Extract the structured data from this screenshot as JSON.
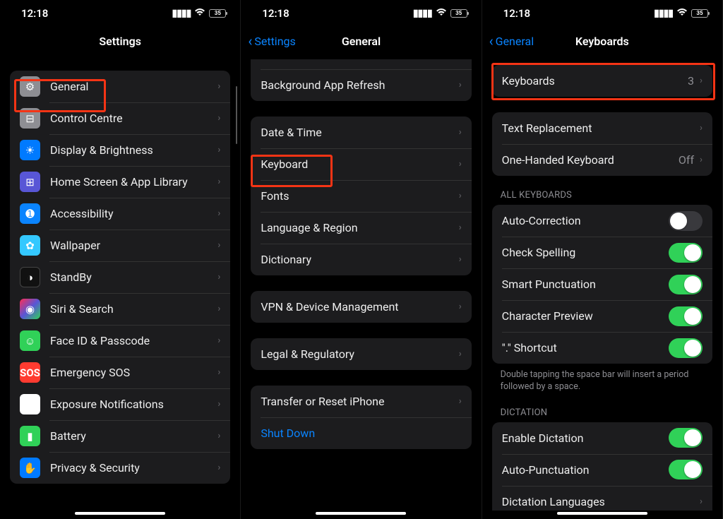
{
  "status": {
    "time": "12:18",
    "battery": "35"
  },
  "p1": {
    "title": "Settings",
    "rows": [
      {
        "name": "general",
        "label": "General",
        "icon": "gear",
        "bg": "bg-grey",
        "glyph": "⚙"
      },
      {
        "name": "control-centre",
        "label": "Control Centre",
        "icon": "switch",
        "bg": "bg-grey",
        "glyph": "⊟"
      },
      {
        "name": "display-brightness",
        "label": "Display & Brightness",
        "icon": "brightness",
        "bg": "bg-blue",
        "glyph": "☀"
      },
      {
        "name": "home-screen",
        "label": "Home Screen & App Library",
        "icon": "grid",
        "bg": "bg-purple",
        "glyph": "⊞"
      },
      {
        "name": "accessibility",
        "label": "Accessibility",
        "icon": "accessibility",
        "bg": "bg-access",
        "glyph": "➊"
      },
      {
        "name": "wallpaper",
        "label": "Wallpaper",
        "icon": "wallpaper",
        "bg": "bg-teal",
        "glyph": "✿"
      },
      {
        "name": "standby",
        "label": "StandBy",
        "icon": "standby",
        "bg": "bg-dark",
        "glyph": "◑"
      },
      {
        "name": "siri-search",
        "label": "Siri & Search",
        "icon": "siri",
        "bg": "bg-grad",
        "glyph": "◉"
      },
      {
        "name": "faceid-passcode",
        "label": "Face ID & Passcode",
        "icon": "faceid",
        "bg": "bg-green",
        "glyph": "☺"
      },
      {
        "name": "emergency-sos",
        "label": "Emergency SOS",
        "icon": "sos",
        "bg": "bg-redtx",
        "glyph": "SOS"
      },
      {
        "name": "exposure-notifications",
        "label": "Exposure Notifications",
        "icon": "exposure",
        "bg": "bg-white",
        "glyph": "✱"
      },
      {
        "name": "battery",
        "label": "Battery",
        "icon": "battery",
        "bg": "bg-greenb",
        "glyph": "▮"
      },
      {
        "name": "privacy-security",
        "label": "Privacy & Security",
        "icon": "hand",
        "bg": "bg-bluep",
        "glyph": "✋"
      }
    ]
  },
  "p2": {
    "back": "Settings",
    "title": "General",
    "group_top": [
      {
        "name": "background-app-refresh",
        "label": "Background App Refresh"
      }
    ],
    "group_mid": [
      {
        "name": "date-time",
        "label": "Date & Time"
      },
      {
        "name": "keyboard",
        "label": "Keyboard"
      },
      {
        "name": "fonts",
        "label": "Fonts"
      },
      {
        "name": "language-region",
        "label": "Language & Region"
      },
      {
        "name": "dictionary",
        "label": "Dictionary"
      }
    ],
    "group_vpn": [
      {
        "name": "vpn-device-mgmt",
        "label": "VPN & Device Management"
      }
    ],
    "group_legal": [
      {
        "name": "legal-regulatory",
        "label": "Legal & Regulatory"
      }
    ],
    "group_reset": [
      {
        "name": "transfer-reset",
        "label": "Transfer or Reset iPhone"
      },
      {
        "name": "shut-down",
        "label": "Shut Down",
        "blue": true
      }
    ]
  },
  "p3": {
    "back": "General",
    "title": "Keyboards",
    "group_kb": [
      {
        "name": "keyboards",
        "label": "Keyboards",
        "value": "3"
      }
    ],
    "group_text": [
      {
        "name": "text-replacement",
        "label": "Text Replacement"
      },
      {
        "name": "one-handed",
        "label": "One-Handed Keyboard",
        "value": "Off"
      }
    ],
    "section_all_label": "ALL KEYBOARDS",
    "group_all": [
      {
        "name": "auto-correction",
        "label": "Auto-Correction",
        "on": false
      },
      {
        "name": "check-spelling",
        "label": "Check Spelling",
        "on": true
      },
      {
        "name": "smart-punctuation",
        "label": "Smart Punctuation",
        "on": true
      },
      {
        "name": "character-preview",
        "label": "Character Preview",
        "on": true
      },
      {
        "name": "period-shortcut",
        "label": "\".\" Shortcut",
        "on": true
      }
    ],
    "footer_all": "Double tapping the space bar will insert a period followed by a space.",
    "section_dict_label": "DICTATION",
    "group_dict": [
      {
        "name": "enable-dictation",
        "label": "Enable Dictation",
        "on": true
      },
      {
        "name": "auto-punctuation",
        "label": "Auto-Punctuation",
        "on": true
      },
      {
        "name": "dictation-languages",
        "label": "Dictation Languages",
        "chevron": true
      }
    ]
  }
}
